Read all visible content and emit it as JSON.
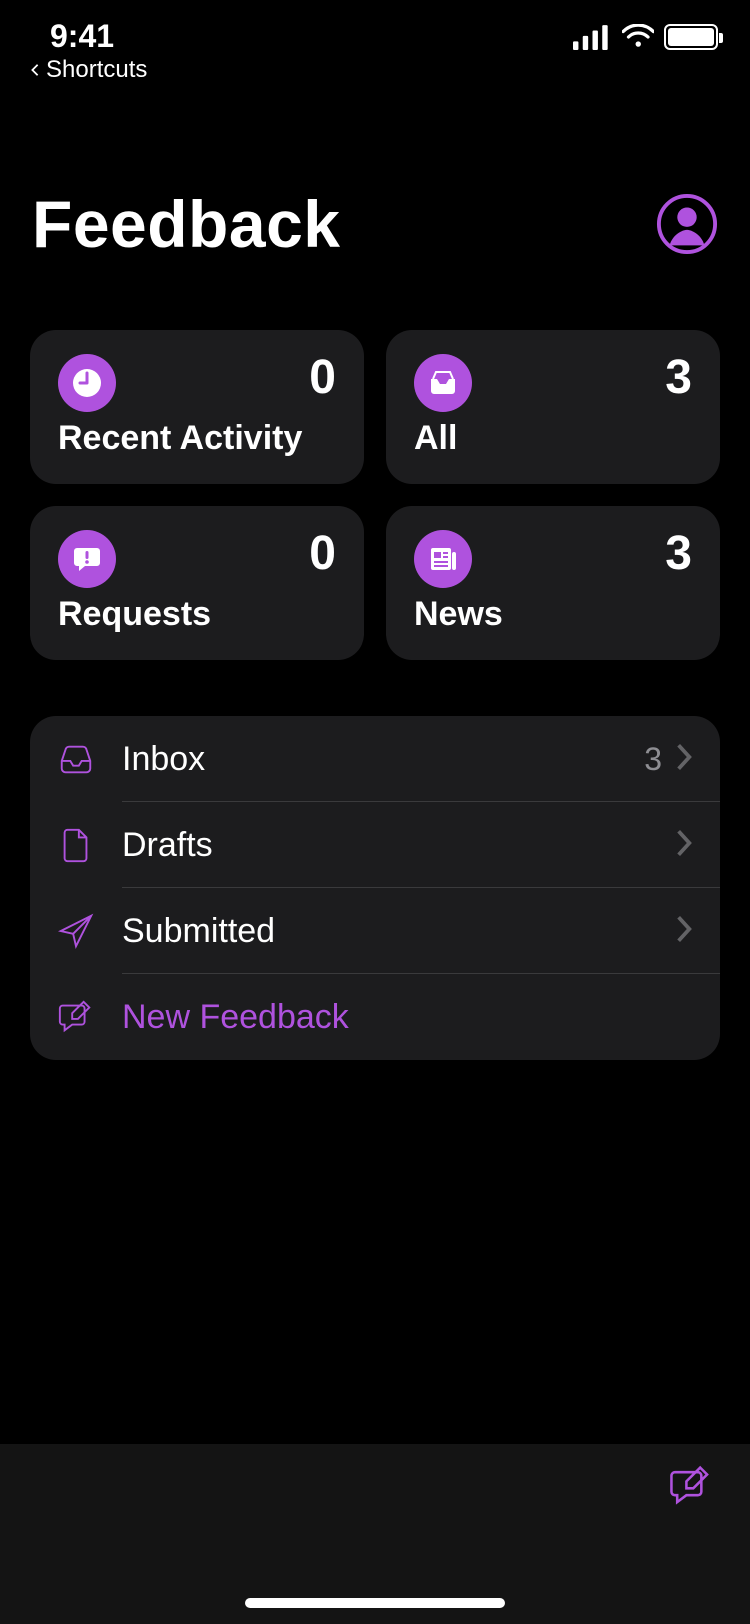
{
  "status": {
    "time": "9:41",
    "back_app": "Shortcuts"
  },
  "header": {
    "title": "Feedback"
  },
  "cards": {
    "recent": {
      "label": "Recent Activity",
      "count": "0"
    },
    "all": {
      "label": "All",
      "count": "3"
    },
    "requests": {
      "label": "Requests",
      "count": "0"
    },
    "news": {
      "label": "News",
      "count": "3"
    }
  },
  "rows": {
    "inbox": {
      "label": "Inbox",
      "badge": "3"
    },
    "drafts": {
      "label": "Drafts"
    },
    "submitted": {
      "label": "Submitted"
    },
    "new": {
      "label": "New Feedback"
    }
  }
}
